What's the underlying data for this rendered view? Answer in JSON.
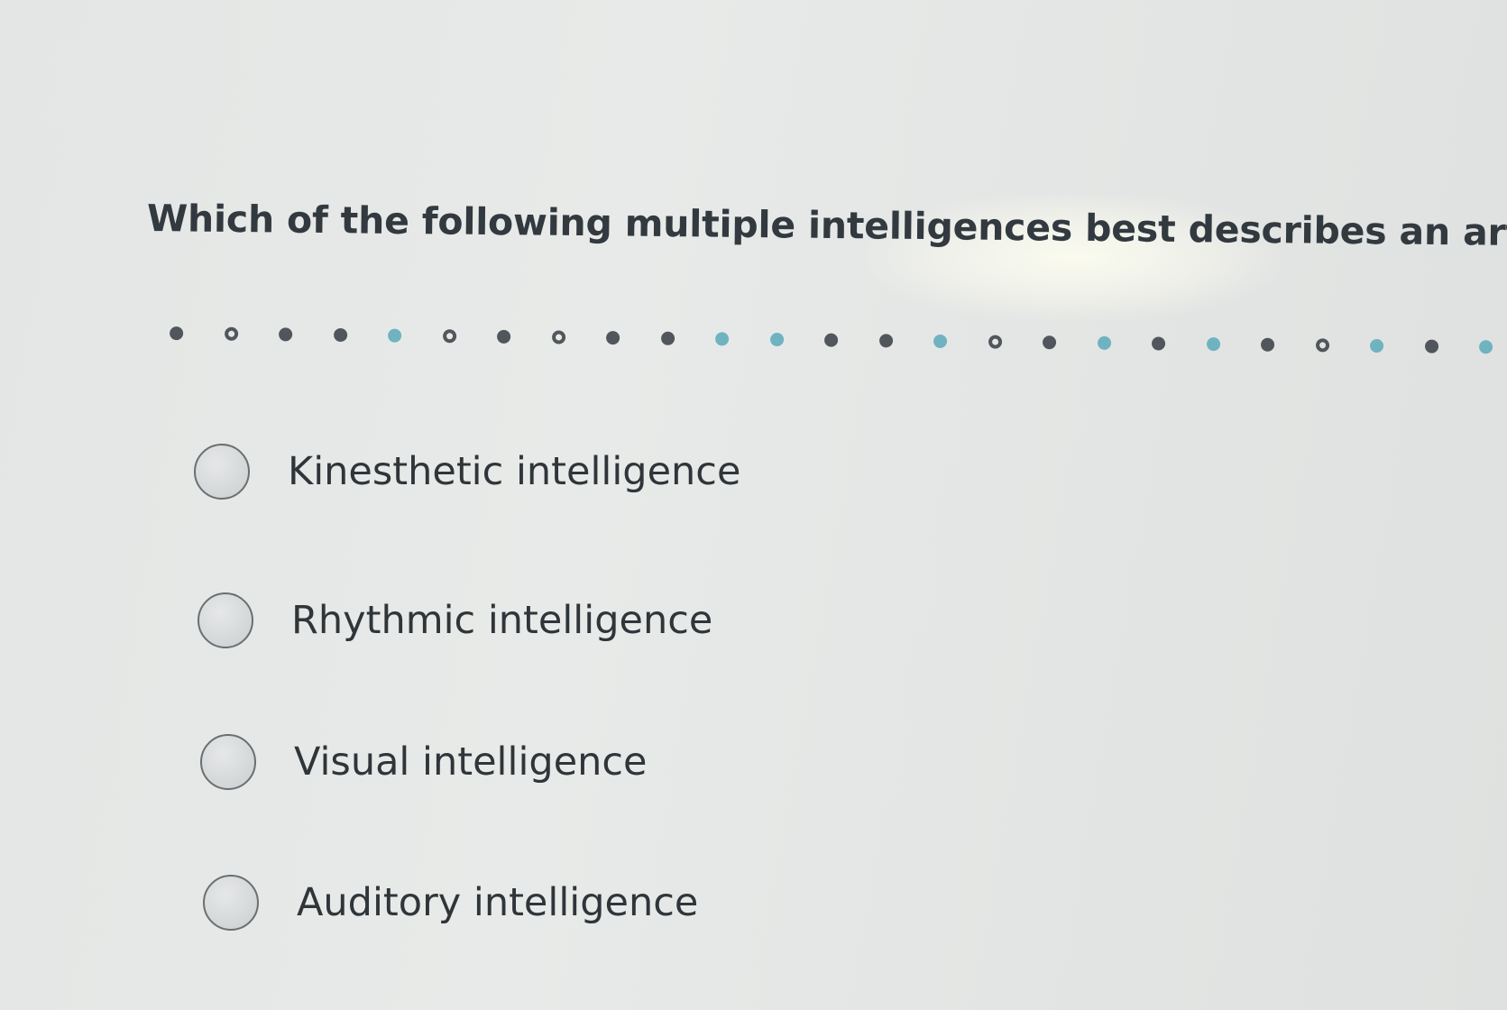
{
  "question": {
    "text": "Which of the following multiple intelligences best describes an artist?"
  },
  "separator": {
    "dots": [
      "filled",
      "ring",
      "filled",
      "filled",
      "teal",
      "ring",
      "filled",
      "ring",
      "filled",
      "filled",
      "teal",
      "teal",
      "filled",
      "filled",
      "teal",
      "ring",
      "filled",
      "teal",
      "filled",
      "teal",
      "filled",
      "ring",
      "teal",
      "filled",
      "teal"
    ]
  },
  "options": [
    {
      "label": "Kinesthetic intelligence",
      "selected": false
    },
    {
      "label": "Rhythmic intelligence",
      "selected": false
    },
    {
      "label": "Visual intelligence",
      "selected": false
    },
    {
      "label": "Auditory intelligence",
      "selected": false
    }
  ],
  "colors": {
    "text": "#2f3539",
    "dot_dark": "#50565b",
    "dot_teal": "#6fb3c1",
    "background": "#e6e8e7"
  }
}
